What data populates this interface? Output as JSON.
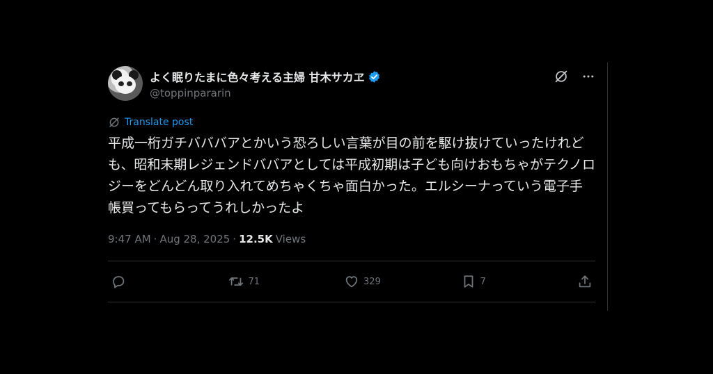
{
  "author": {
    "display_name": "よく眠りたまに色々考える主婦 甘木サカヱ",
    "handle": "@toppinpararin",
    "verified": true
  },
  "header_icons": [
    "grok-icon",
    "more-icon"
  ],
  "translate_label": "Translate post",
  "body_text": "平成一桁ガチバババアとかいう恐ろしい言葉が目の前を駆け抜けていったけれども、昭和末期レジェンドババアとしては平成初期は子ども向けおもちゃがテクノロジーをどんどん取り入れてめちゃくちゃ面白かった。エルシーナっていう電子手帳買ってもらってうれしかったよ",
  "meta": {
    "time": "9:47 AM",
    "sep1": "·",
    "date": "Aug 28, 2025",
    "sep2": "·",
    "views_count": "12.5K",
    "views_label": "Views"
  },
  "actions": {
    "reply_count": "",
    "repost_count": "71",
    "like_count": "329",
    "bookmark_count": "7"
  },
  "colors": {
    "background": "#000000",
    "text": "#e7e9ea",
    "muted": "#71767b",
    "accent": "#1d9bf0",
    "divider": "#2f3336"
  }
}
